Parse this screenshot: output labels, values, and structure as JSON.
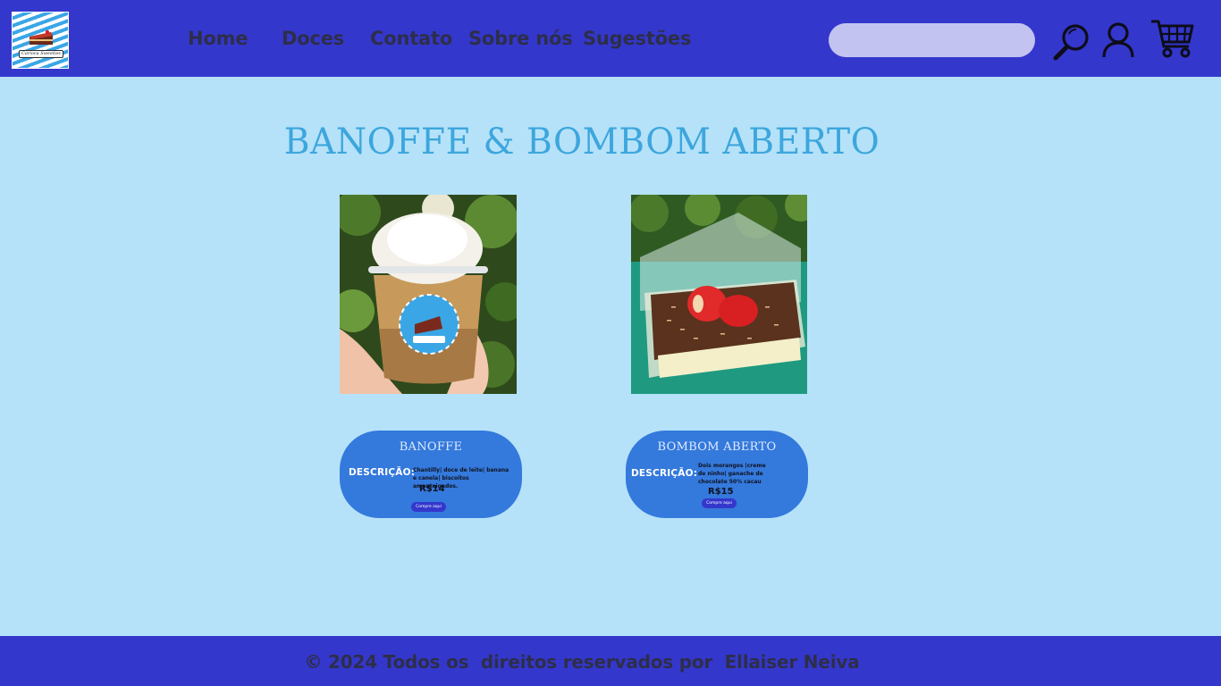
{
  "header": {
    "logo_text": "Carioca Sweeties",
    "nav": [
      {
        "label": "Home"
      },
      {
        "label": "Doces"
      },
      {
        "label": "Contato"
      },
      {
        "label": "Sobre nós"
      },
      {
        "label": "Sugestões"
      }
    ],
    "search": {
      "value": "",
      "placeholder": ""
    },
    "icons": [
      "search-icon",
      "user-icon",
      "cart-icon"
    ]
  },
  "main": {
    "title": "BANOFFE & BOMBOM ABERTO",
    "products": [
      {
        "name": "BANOFFE",
        "description_label": "DESCRIÇÃO:",
        "description": "Chantilly| doce de leite| banana e canela| biscoitos amanteigados.",
        "price": "R$14",
        "buy_label": "Compre aqui"
      },
      {
        "name": "BOMBOM ABERTO",
        "description_label": "DESCRIÇÃO:",
        "description": "Dois morangos |creme de ninho| ganache de chocolate 50% cacau",
        "price": "R$15",
        "buy_label": "Compre aqui"
      }
    ]
  },
  "footer": {
    "copyright": "© 2024 Todos os  direitos reservados por  Ellaiser Neiva"
  },
  "colors": {
    "header_bg": "#3437cc",
    "page_bg": "#b5e2f9",
    "title": "#3da6dd",
    "card_bg": "#3479dc",
    "search_bg": "#c2c3f0"
  }
}
